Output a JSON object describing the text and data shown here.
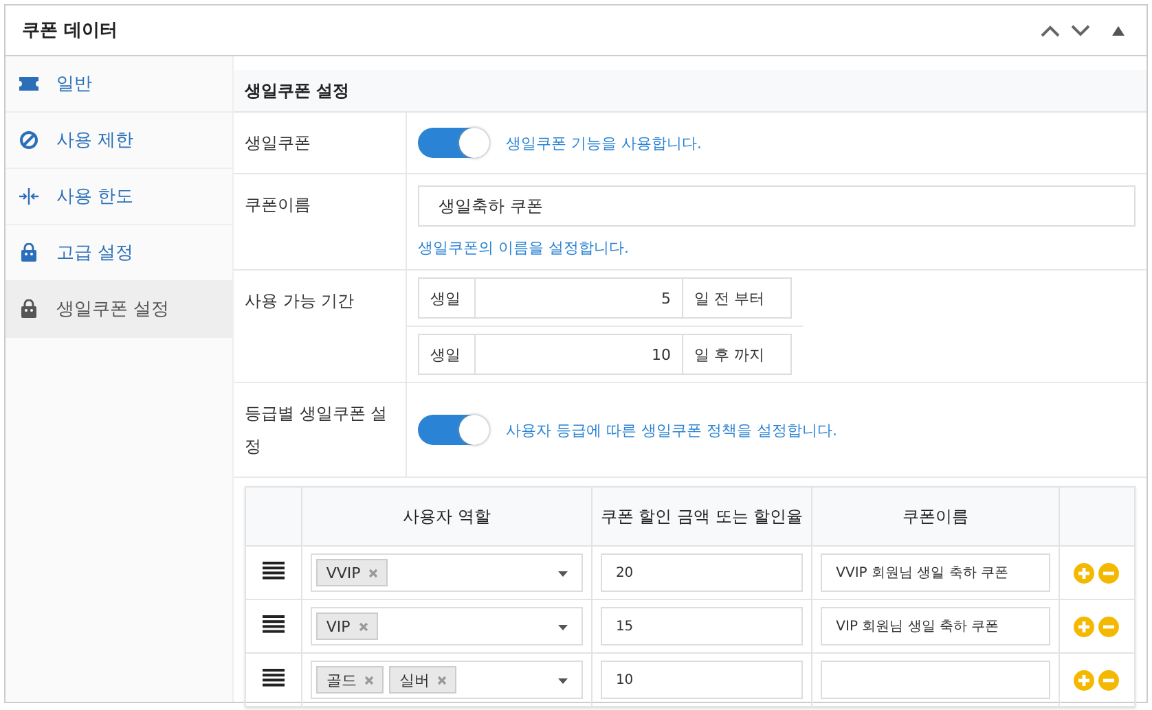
{
  "panel": {
    "title": "쿠폰 데이터"
  },
  "sidebar": {
    "items": [
      {
        "label": "일반",
        "kind": "ticket",
        "selected": false
      },
      {
        "label": "사용 제한",
        "kind": "ban",
        "selected": false
      },
      {
        "label": "사용 한도",
        "kind": "limit",
        "selected": false
      },
      {
        "label": "고급 설정",
        "kind": "bag",
        "selected": false
      },
      {
        "label": "생일쿠폰 설정",
        "kind": "bag",
        "selected": true
      }
    ]
  },
  "section": {
    "title": "생일쿠폰 설정",
    "rows": [
      {
        "kind": "toggle",
        "label": "생일쿠폰",
        "on": true,
        "description": "생일쿠폰 기능을 사용합니다."
      },
      {
        "kind": "text",
        "label": "쿠폰이름",
        "value": "생일축하 쿠폰",
        "description": "생일쿠폰의 이름을 설정합니다."
      },
      {
        "kind": "period",
        "label": "사용 가능 기간",
        "ranges": [
          {
            "prefix": "생일",
            "value": "5",
            "suffix": "일 전 부터"
          },
          {
            "prefix": "생일",
            "value": "10",
            "suffix": "일 후 까지"
          }
        ]
      },
      {
        "kind": "toggle",
        "label": "등급별 생일쿠폰 설정",
        "on": true,
        "description": "사용자 등급에 따른 생일쿠폰 정책을 설정합니다."
      }
    ]
  },
  "table": {
    "columns": [
      "사용자 역할",
      "쿠폰 할인 금액 또는 할인율",
      "쿠폰이름"
    ],
    "rows": [
      {
        "roles": [
          "VVIP"
        ],
        "amount": "20",
        "name": "VVIP 회원님 생일 축하 쿠폰"
      },
      {
        "roles": [
          "VIP"
        ],
        "amount": "15",
        "name": "VIP 회원님 생일 축하 쿠폰"
      },
      {
        "roles": [
          "골드",
          "실버"
        ],
        "amount": "10"
      }
    ]
  }
}
